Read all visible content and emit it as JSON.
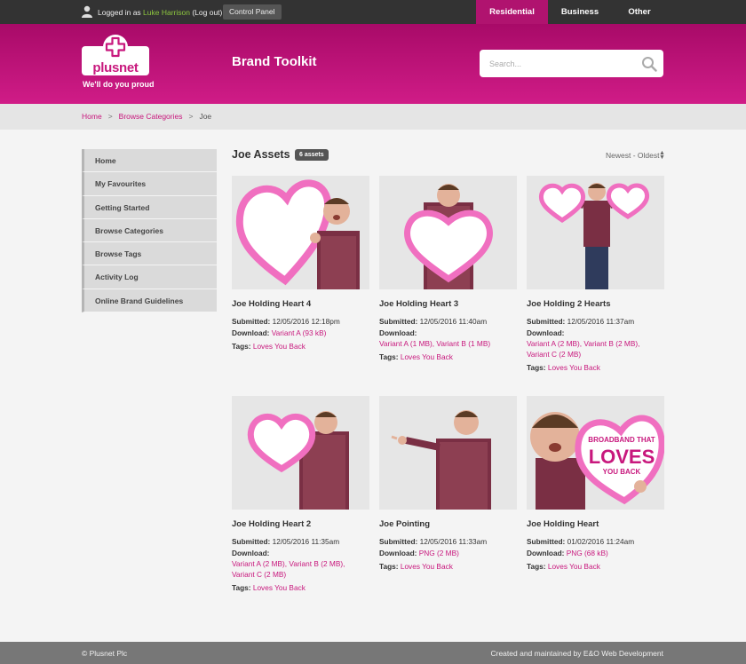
{
  "topbar": {
    "logged_in_prefix": "Logged in as ",
    "username": "Luke Harrison",
    "logout": "(Log out)",
    "control_panel": "Control Panel",
    "segments": [
      "Residential",
      "Business",
      "Other"
    ]
  },
  "header": {
    "logo_word": "plusnet",
    "tagline": "We'll do you proud",
    "title": "Brand Toolkit",
    "search_placeholder": "Search..."
  },
  "breadcrumb": {
    "home": "Home",
    "category": "Browse Categories",
    "current": "Joe",
    "separator": ">"
  },
  "sidebar": {
    "items": [
      "Home",
      "My Favourites",
      "Getting Started",
      "Browse Categories",
      "Browse Tags",
      "Activity Log",
      "Online Brand Guidelines"
    ]
  },
  "main": {
    "title": "Joe Assets",
    "count": "6 assets",
    "sort": "Newest - Oldest",
    "labels": {
      "submitted": "Submitted:",
      "download": "Download:",
      "tags": "Tags:"
    },
    "assets": [
      {
        "title": "Joe Holding Heart 4",
        "submitted": "12/05/2016 12:18pm",
        "download_a": "Variant A (93 kB)",
        "tags": "Loves You Back"
      },
      {
        "title": "Joe Holding Heart 3",
        "submitted": "12/05/2016 11:40am",
        "download_a": "Variant A (1 MB),",
        "download_b": "Variant B (1 MB)",
        "tags": "Loves You Back"
      },
      {
        "title": "Joe Holding 2 Hearts",
        "submitted": "12/05/2016 11:37am",
        "download_a": "Variant A (2 MB),",
        "download_b": "Variant B (2 MB),",
        "download_c": "Variant C (2 MB)",
        "tags": "Loves You Back"
      },
      {
        "title": "Joe Holding Heart 2",
        "submitted": "12/05/2016 11:35am",
        "download_a": "Variant A (2 MB),",
        "download_b": "Variant B (2 MB),",
        "download_c": "Variant C (2 MB)",
        "tags": "Loves You Back"
      },
      {
        "title": "Joe Pointing",
        "submitted": "12/05/2016 11:33am",
        "download_a": "PNG (2 MB)",
        "tags": "Loves You Back"
      },
      {
        "title": "Joe Holding Heart",
        "submitted": "01/02/2016 11:24am",
        "download_a": "PNG (68 kB)",
        "tags": "Loves You Back",
        "thumb_text_1": "BROADBAND THAT",
        "thumb_text_2": "LOVES",
        "thumb_text_3": "YOU BACK"
      }
    ]
  },
  "footer": {
    "left": "© Plusnet Plc",
    "right": "Created and maintained by E&O Web Development"
  },
  "colors": {
    "brand": "#c8187d",
    "topbar": "#333333",
    "footer": "#777777"
  }
}
